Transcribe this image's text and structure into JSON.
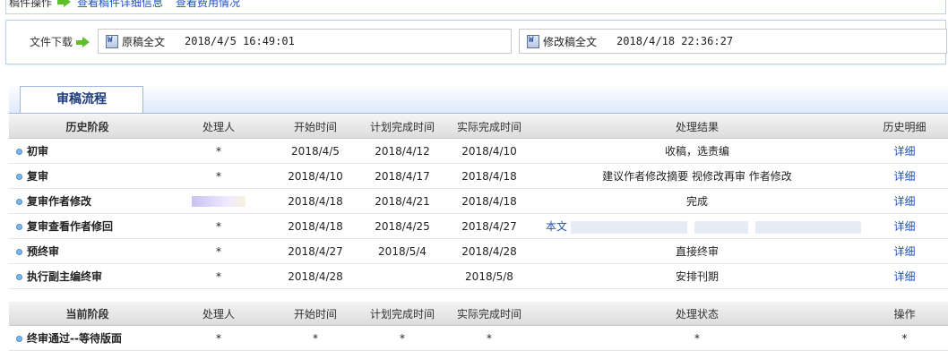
{
  "ops": {
    "label": "稿件操作",
    "link1": "查看稿件详细信息",
    "link2": "查看费用情况"
  },
  "download": {
    "label": "文件下载",
    "files": [
      {
        "name": "原稿全文",
        "time": "2018/4/5 16:49:01"
      },
      {
        "name": "修改稿全文",
        "time": "2018/4/18 22:36:27"
      }
    ]
  },
  "tab": {
    "label": "审稿流程"
  },
  "history": {
    "headers": [
      "历史阶段",
      "处理人",
      "开始时间",
      "计划完成时间",
      "实际完成时间",
      "处理结果",
      "历史明细"
    ],
    "rows": [
      {
        "stage": "初审",
        "handler": "*",
        "start": "2018/4/5",
        "plan": "2018/4/12",
        "actual": "2018/4/10",
        "result": "收稿，选责编",
        "detail": "详细"
      },
      {
        "stage": "复审",
        "handler": "*",
        "start": "2018/4/10",
        "plan": "2018/4/17",
        "actual": "2018/4/18",
        "result": "建议作者修改摘要 视修改再审 作者修改",
        "detail": "详细"
      },
      {
        "stage": "复审作者修改",
        "handler": "",
        "start": "2018/4/18",
        "plan": "2018/4/21",
        "actual": "2018/4/18",
        "result": "完成",
        "detail": "详细"
      },
      {
        "stage": "复审查看作者修回",
        "handler": "*",
        "start": "2018/4/18",
        "plan": "2018/4/25",
        "actual": "2018/4/27",
        "result": "本文",
        "result_tail": "...",
        "detail": "详细"
      },
      {
        "stage": "预终审",
        "handler": "*",
        "start": "2018/4/27",
        "plan": "2018/5/4",
        "actual": "2018/4/28",
        "result": "直接终审",
        "detail": "详细"
      },
      {
        "stage": "执行副主编终审",
        "handler": "*",
        "start": "2018/4/28",
        "plan": "",
        "actual": "2018/5/8",
        "result": "安排刊期",
        "detail": "详细"
      }
    ]
  },
  "current": {
    "headers": [
      "当前阶段",
      "处理人",
      "开始时间",
      "计划完成时间",
      "实际完成时间",
      "处理状态",
      "操作"
    ],
    "row": {
      "stage": "终审通过--等待版面",
      "handler": "*",
      "start": "*",
      "plan": "*",
      "actual": "*",
      "status": "*",
      "op": "*"
    }
  },
  "colors": {
    "link": "#1f4fc0",
    "tab_text": "#1e3c7a",
    "border": "#b9d3ee"
  }
}
